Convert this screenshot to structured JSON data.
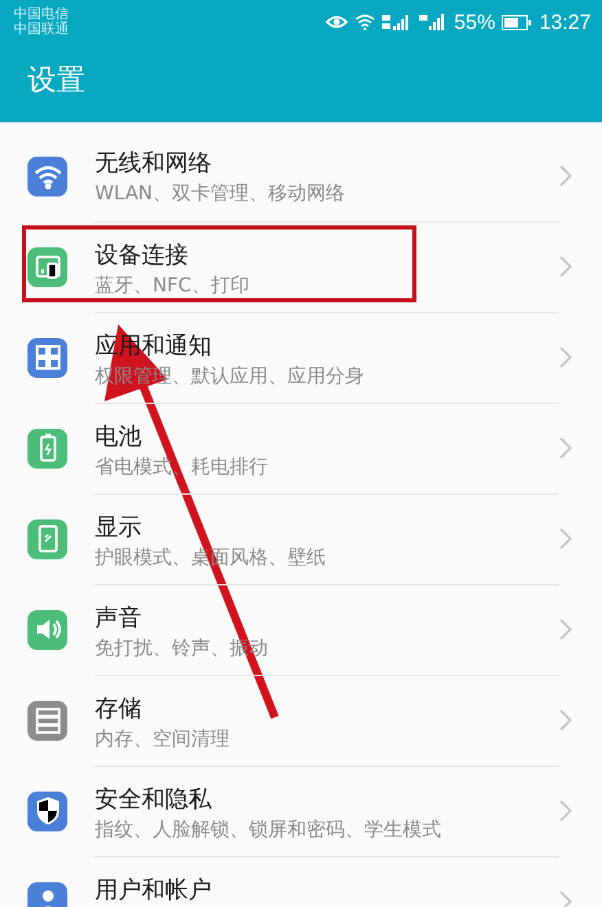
{
  "status_bar": {
    "carriers": [
      "中国电信",
      "中国联通"
    ],
    "battery": "55%",
    "time": "13:27"
  },
  "header": {
    "title": "设置"
  },
  "items": [
    {
      "color": "#4a80d8",
      "title": "无线和网络",
      "subtitle": "WLAN、双卡管理、移动网络",
      "highlighted": false
    },
    {
      "color": "#4cbd78",
      "title": "设备连接",
      "subtitle": "蓝牙、NFC、打印",
      "highlighted": true
    },
    {
      "color": "#4a80d8",
      "title": "应用和通知",
      "subtitle": "权限管理、默认应用、应用分身",
      "highlighted": false
    },
    {
      "color": "#4cbd78",
      "title": "电池",
      "subtitle": "省电模式、耗电排行",
      "highlighted": false
    },
    {
      "color": "#4cbd78",
      "title": "显示",
      "subtitle": "护眼模式、桌面风格、壁纸",
      "highlighted": false
    },
    {
      "color": "#4cbd78",
      "title": "声音",
      "subtitle": "免打扰、铃声、振动",
      "highlighted": false
    },
    {
      "color": "#8c8c8c",
      "title": "存储",
      "subtitle": "内存、空间清理",
      "highlighted": false
    },
    {
      "color": "#4a80d8",
      "title": "安全和隐私",
      "subtitle": "指纹、人脸解锁、锁屏和密码、学生模式",
      "highlighted": false
    },
    {
      "color": "#4a80d8",
      "title": "用户和帐户",
      "highlighted": false
    }
  ]
}
